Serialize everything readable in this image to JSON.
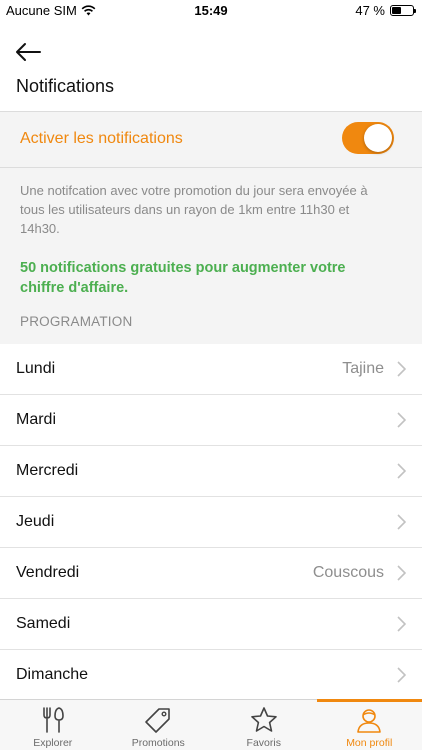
{
  "status_bar": {
    "carrier": "Aucune SIM",
    "time": "15:49",
    "battery": "47 %",
    "battery_level": 0.47
  },
  "header": {
    "back_icon": "arrow-left-icon",
    "title": "Notifications"
  },
  "notifications": {
    "toggle_label": "Activer les notifications",
    "enabled": true,
    "info_text": "Une notifcation avec votre promotion du jour sera envoyée à tous les utilisateurs dans un rayon de 1km entre 11h30 et 14h30.",
    "promo_text": "50 notifications gratuites pour augmenter votre chiffre d'affaire.",
    "section_title": "PROGRAMATION"
  },
  "days": [
    {
      "name": "Lundi",
      "value": "Tajine"
    },
    {
      "name": "Mardi",
      "value": ""
    },
    {
      "name": "Mercredi",
      "value": ""
    },
    {
      "name": "Jeudi",
      "value": ""
    },
    {
      "name": "Vendredi",
      "value": "Couscous"
    },
    {
      "name": "Samedi",
      "value": ""
    },
    {
      "name": "Dimanche",
      "value": ""
    }
  ],
  "tabbar": {
    "items": [
      {
        "label": "Explorer",
        "icon": "fork-knife-icon",
        "active": false
      },
      {
        "label": "Promotions",
        "icon": "tag-icon",
        "active": false
      },
      {
        "label": "Favoris",
        "icon": "star-icon",
        "active": false
      },
      {
        "label": "Mon profil",
        "icon": "user-icon",
        "active": true
      }
    ]
  },
  "colors": {
    "accent": "#f0880f",
    "promo_green": "#4caf50",
    "muted_text": "#8a8a8a",
    "section_bg": "#f4f4f4"
  }
}
